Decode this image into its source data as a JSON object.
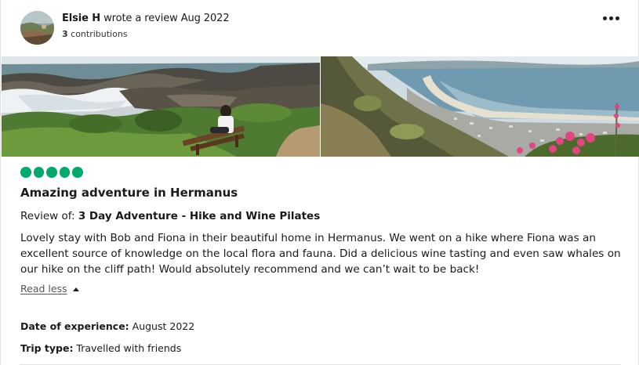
{
  "reviewer": {
    "name": "Elsie H",
    "action": " wrote a review Aug 2022",
    "contribution_count": "3",
    "contribution_label": " contributions"
  },
  "rating": {
    "value": 5,
    "max": 5
  },
  "review": {
    "title": "Amazing adventure in Hermanus",
    "review_of_label": "Review of: ",
    "product": "3 Day Adventure - Hike and Wine Pilates",
    "body": "Lovely stay with Bob and Fiona in their beautiful home in Hermanus. We went on a hike where Fiona was an excellent source of knowledge on the local flora and fauna. Did a delicious wine tasting and even saw whales on our hike on the cliff path! Would absolutely recommend and we can’t wait to be back!",
    "read_less": "Read less"
  },
  "details": {
    "date_label": "Date of experience:",
    "date_value": " August 2022",
    "trip_label": "Trip type:",
    "trip_value": " Travelled with friends"
  },
  "icons": {
    "more": "more-horizontal-icon",
    "rating_bubble": "rating-bubble-icon",
    "read_less": "caret-up-icon"
  },
  "colors": {
    "rating_green": "#00aa6c",
    "text": "#1a1a1a",
    "muted": "#555555",
    "divider": "#e0e0e0"
  }
}
